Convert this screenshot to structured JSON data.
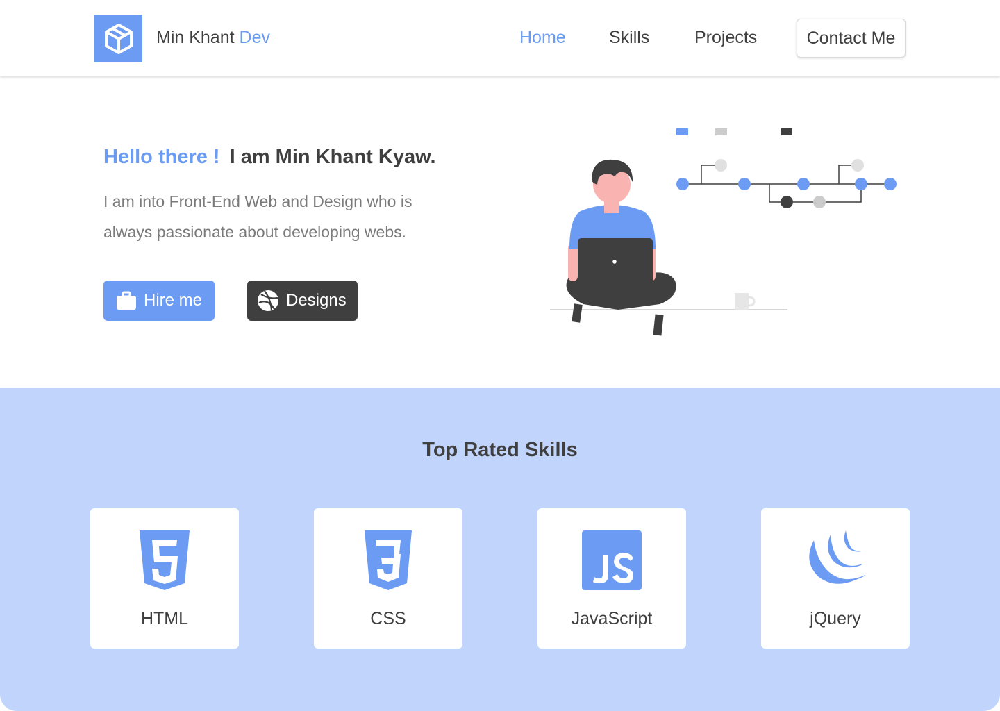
{
  "header": {
    "brand_name": "Min Khant",
    "brand_accent": "Dev",
    "nav": {
      "home": "Home",
      "skills": "Skills",
      "projects": "Projects",
      "contact": "Contact Me"
    }
  },
  "hero": {
    "hello": "Hello there !",
    "intro": "I am Min Khant Kyaw.",
    "description": "I am into Front-End Web and Design who is always passionate about developing webs.",
    "hire_label": "Hire me",
    "designs_label": "Designs"
  },
  "skills": {
    "title": "Top Rated Skills",
    "items": [
      {
        "label": "HTML",
        "icon": "html5-icon"
      },
      {
        "label": "CSS",
        "icon": "css3-icon"
      },
      {
        "label": "JavaScript",
        "icon": "javascript-icon"
      },
      {
        "label": "jQuery",
        "icon": "jquery-icon"
      }
    ]
  },
  "colors": {
    "accent": "#6b9bf2",
    "dark": "#3f3f3f",
    "section_bg": "#c1d4fc",
    "skin": "#f9b4b2"
  }
}
